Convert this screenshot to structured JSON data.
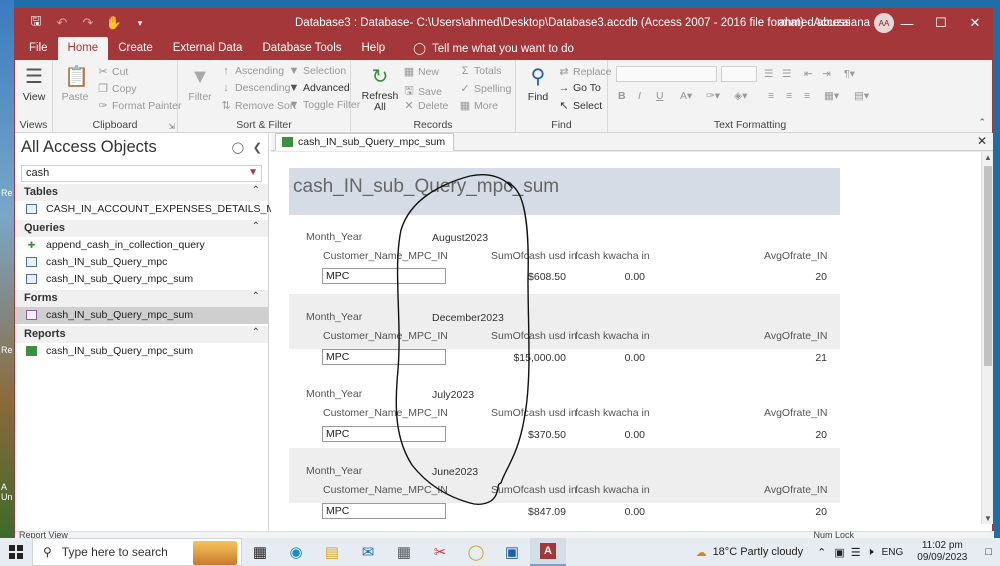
{
  "window": {
    "title": "Database3 : Database- C:\\Users\\ahmed\\Desktop\\Database3.accdb (Access 2007 - 2016 file format)  -  Access",
    "user": "ahmed abuzaiana",
    "avatar_initials": "AA",
    "accent_color": "#a4373a"
  },
  "ribbon_tabs": [
    "File",
    "Home",
    "Create",
    "External Data",
    "Database Tools",
    "Help"
  ],
  "tell_me": "Tell me what you want to do",
  "ribbon": {
    "views": {
      "view": "View",
      "group": "Views"
    },
    "clipboard": {
      "paste": "Paste",
      "cut": "Cut",
      "copy": "Copy",
      "format_painter": "Format Painter",
      "group": "Clipboard"
    },
    "sort_filter": {
      "filter": "Filter",
      "ascending": "Ascending",
      "descending": "Descending",
      "remove_sort": "Remove Sort",
      "selection": "Selection",
      "advanced": "Advanced",
      "toggle_filter": "Toggle Filter",
      "group": "Sort & Filter"
    },
    "records": {
      "refresh": "Refresh All",
      "new": "New",
      "save": "Save",
      "delete": "Delete",
      "totals": "Totals",
      "spelling": "Spelling",
      "more": "More",
      "group": "Records"
    },
    "find": {
      "find": "Find",
      "replace": "Replace",
      "goto": "Go To",
      "select": "Select",
      "group": "Find"
    },
    "text_formatting": {
      "group": "Text Formatting"
    }
  },
  "nav": {
    "title": "All Access Objects",
    "search": "cash",
    "sections": [
      {
        "name": "Tables",
        "items": [
          "CASH_IN_ACCOUNT_EXPENSES_DETAILS_MPC"
        ]
      },
      {
        "name": "Queries",
        "items": [
          "append_cash_in_collection_query",
          "cash_IN_sub_Query_mpc",
          "cash_IN_sub_Query_mpc_sum"
        ]
      },
      {
        "name": "Forms",
        "items": [
          "cash_IN_sub_Query_mpc_sum"
        ]
      },
      {
        "name": "Reports",
        "items": [
          "cash_IN_sub_Query_mpc_sum"
        ]
      }
    ]
  },
  "document": {
    "tab": "cash_IN_sub_Query_mpc_sum",
    "report_title": "cash_IN_sub_Query_mpc_sum",
    "labels": {
      "month_year": "Month_Year",
      "customer": "Customer_Name_MPC_IN",
      "sum_usd": "SumOfcash usd in",
      "kwacha": "fcash kwacha in",
      "avg_rate": "AvgOfrate_IN"
    },
    "groups": [
      {
        "month": "August2023",
        "customer": "MPC",
        "usd": "$608.50",
        "kwacha": "0.00",
        "rate": "20"
      },
      {
        "month": "December2023",
        "customer": "MPC",
        "usd": "$15,000.00",
        "kwacha": "0.00",
        "rate": "21"
      },
      {
        "month": "July2023",
        "customer": "MPC",
        "usd": "$370.50",
        "kwacha": "0.00",
        "rate": "20"
      },
      {
        "month": "June2023",
        "customer": "MPC",
        "usd": "$847.09",
        "kwacha": "0.00",
        "rate": "20"
      }
    ]
  },
  "status": {
    "left": "Report View",
    "right": "Num Lock"
  },
  "taskbar": {
    "search_placeholder": "Type here to search",
    "weather": "18°C  Partly cloudy",
    "language": "ENG",
    "time": "11:02 pm",
    "date": "09/09/2023"
  }
}
